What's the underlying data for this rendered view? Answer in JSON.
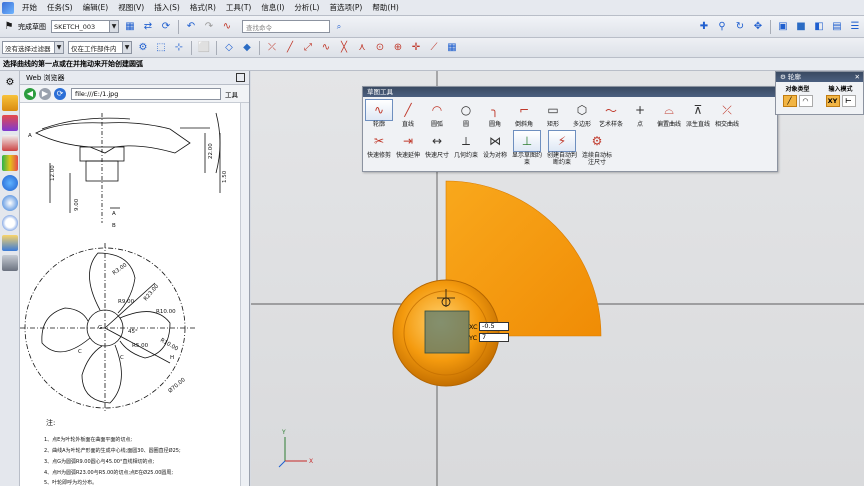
{
  "menu": {
    "items": [
      "开始",
      "任务(S)",
      "编辑(E)",
      "视图(V)",
      "插入(S)",
      "格式(R)",
      "工具(T)",
      "信息(I)",
      "分析(L)",
      "首选项(P)",
      "帮助(H)"
    ]
  },
  "toolbar": {
    "finish_sketch": "完成草图",
    "sketch_name": "SKETCH_003",
    "command_search_placeholder": "查找命令",
    "selection_filter": "没有选择过滤器",
    "work_part_scope": "仅在工作部件内"
  },
  "cue_line": "选择曲线的第一点或在并拖动来开始创建圆弧",
  "web_browser": {
    "title": "Web 浏览器",
    "url": "file:///E:/1.jpg",
    "tools_label": "工具",
    "drawing": {
      "dims_top": [
        "12.00",
        "9.00",
        "A",
        "B",
        "22.00",
        "1.50",
        "A"
      ],
      "dims_fan": [
        "R3.00",
        "R9.00",
        "R23.00",
        "R10.00",
        "45°",
        "R5.00",
        "R10.00",
        "G",
        "H",
        "C",
        "C",
        "Ø70.00"
      ],
      "notes_title": "注:",
      "notes": [
        "1、点E为叶轮外板面在曲面平面的切点;",
        "2、曲线A为叶轮产形面的生成中心线;面圆30、圆圈直径Ø25;",
        "3、点G为圆弧R9.00圆心与45.00°直线相切的点;",
        "4、点H为圆弧R23.00与R5.00的切点;点E在Ø25.00圆周;",
        "5、叶轮即呼为均分布。"
      ]
    }
  },
  "sketch_tools": {
    "title": "草图工具",
    "row1": [
      "轮廓",
      "直线",
      "圆弧",
      "圆",
      "圆角",
      "倒斜角",
      "矩形",
      "多边形",
      "艺术样条",
      "点",
      "偏置曲线",
      "派生直线",
      "相交曲线"
    ],
    "row2": [
      "快速修剪",
      "快速延伸",
      "快速尺寸",
      "几何约束",
      "设为对称",
      "显示草图约束",
      "创建自动判断约束",
      "连续自动标注尺寸"
    ]
  },
  "contour_panel": {
    "title": "轮廓",
    "object_type": "对象类型",
    "input_mode": "输入模式",
    "mode_xy": "XY"
  },
  "coord_input": {
    "xc_label": "XC",
    "xc_value": "-0.5",
    "yc_label": "YC",
    "yc_value": "7"
  },
  "axis": {
    "x": "X",
    "y": "Y"
  },
  "colors": {
    "sector": "#f7a21b",
    "circle": "#f49a0e",
    "ui_header": "#3a4a62"
  }
}
